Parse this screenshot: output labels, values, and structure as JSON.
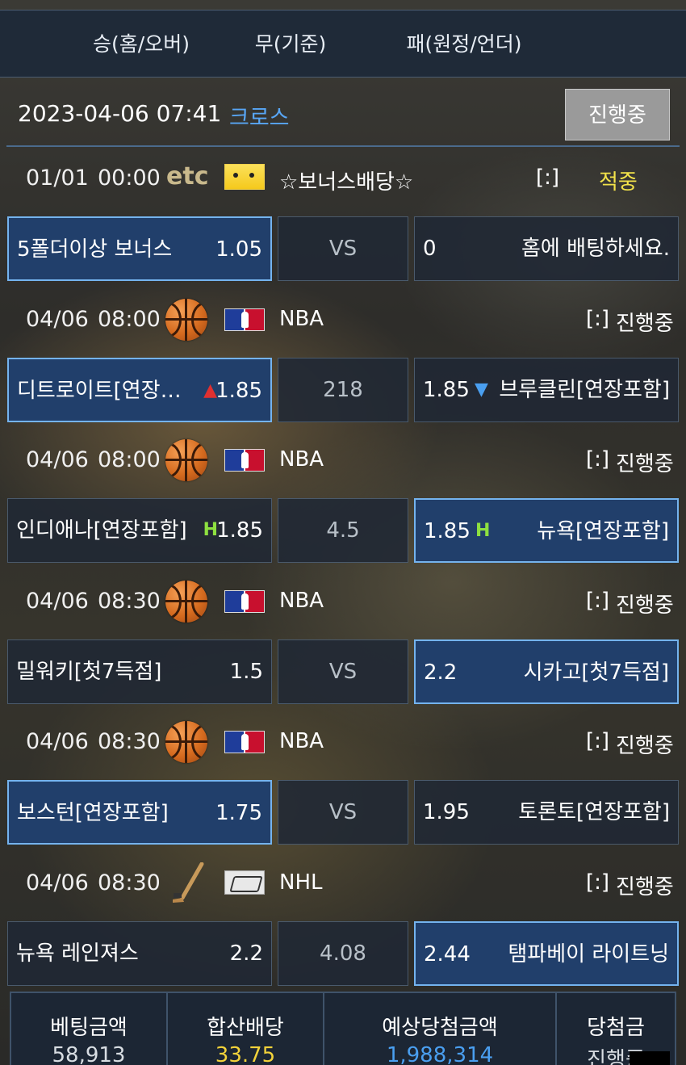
{
  "header": {
    "col_home": "승(홈/오버)",
    "col_draw": "무(기준)",
    "col_away": "패(원정/언더)"
  },
  "info": {
    "datetime": "2023-04-06 07:41",
    "type": "크로스",
    "status": "진행중"
  },
  "games": [
    {
      "date": "01/01",
      "time": "00:00",
      "sport_icon": "etc-icon",
      "sport_text": "etc",
      "league_logo": "pikachu-icon",
      "league": "☆보너스배당☆",
      "score": "[:]",
      "status": "적중",
      "home": {
        "team": "5폴더이상 보너스",
        "odds": "1.05",
        "selected": true,
        "indicator": ""
      },
      "mid": "VS",
      "away": {
        "team": "홈에 배팅하세요.",
        "odds": "0",
        "selected": false,
        "indicator": ""
      }
    },
    {
      "date": "04/06",
      "time": "08:00",
      "sport_icon": "basketball-icon",
      "league_logo": "nba-logo-icon",
      "league": "NBA",
      "score": "[:]",
      "status": "진행중",
      "home": {
        "team": "디트로이트[연장…",
        "odds": "1.85",
        "selected": true,
        "indicator": "up"
      },
      "mid": "218",
      "away": {
        "team": "브루클린[연장포함]",
        "odds": "1.85",
        "selected": false,
        "indicator": "down"
      }
    },
    {
      "date": "04/06",
      "time": "08:00",
      "sport_icon": "basketball-icon",
      "league_logo": "nba-logo-icon",
      "league": "NBA",
      "score": "[:]",
      "status": "진행중",
      "home": {
        "team": "인디애나[연장포함]",
        "odds": "1.85",
        "selected": false,
        "indicator": "H"
      },
      "mid": "4.5",
      "away": {
        "team": "뉴욕[연장포함]",
        "odds": "1.85",
        "selected": true,
        "indicator": "H"
      }
    },
    {
      "date": "04/06",
      "time": "08:30",
      "sport_icon": "basketball-icon",
      "league_logo": "nba-logo-icon",
      "league": "NBA",
      "score": "[:]",
      "status": "진행중",
      "home": {
        "team": "밀워키[첫7득점]",
        "odds": "1.5",
        "selected": false,
        "indicator": ""
      },
      "mid": "VS",
      "away": {
        "team": "시카고[첫7득점]",
        "odds": "2.2",
        "selected": true,
        "indicator": ""
      }
    },
    {
      "date": "04/06",
      "time": "08:30",
      "sport_icon": "basketball-icon",
      "league_logo": "nba-logo-icon",
      "league": "NBA",
      "score": "[:]",
      "status": "진행중",
      "home": {
        "team": "보스턴[연장포함]",
        "odds": "1.75",
        "selected": true,
        "indicator": ""
      },
      "mid": "VS",
      "away": {
        "team": "토론토[연장포함]",
        "odds": "1.95",
        "selected": false,
        "indicator": ""
      }
    },
    {
      "date": "04/06",
      "time": "08:30",
      "sport_icon": "hockey-stick-icon",
      "league_logo": "nhl-logo-icon",
      "league": "NHL",
      "score": "[:]",
      "status": "진행중",
      "home": {
        "team": "뉴욕 레인져스",
        "odds": "2.2",
        "selected": false,
        "indicator": ""
      },
      "mid": "4.08",
      "away": {
        "team": "탬파베이 라이트닝",
        "odds": "2.44",
        "selected": true,
        "indicator": ""
      }
    }
  ],
  "summary": {
    "bet_label": "베팅금액",
    "bet_value": "58,913",
    "odds_label": "합산배당",
    "odds_value": "33.75",
    "expected_label": "예상당첨금액",
    "expected_value": "1,988,314",
    "win_label": "당첨금",
    "win_value": "진행중"
  },
  "colors": {
    "accent_blue": "#58a6f5",
    "selected_bg": "#213f6b",
    "selected_border": "#74b3ee",
    "hit_yellow": "#f2e24a",
    "odds_gold": "#f2d23a",
    "expected_blue": "#4a9ff0"
  }
}
